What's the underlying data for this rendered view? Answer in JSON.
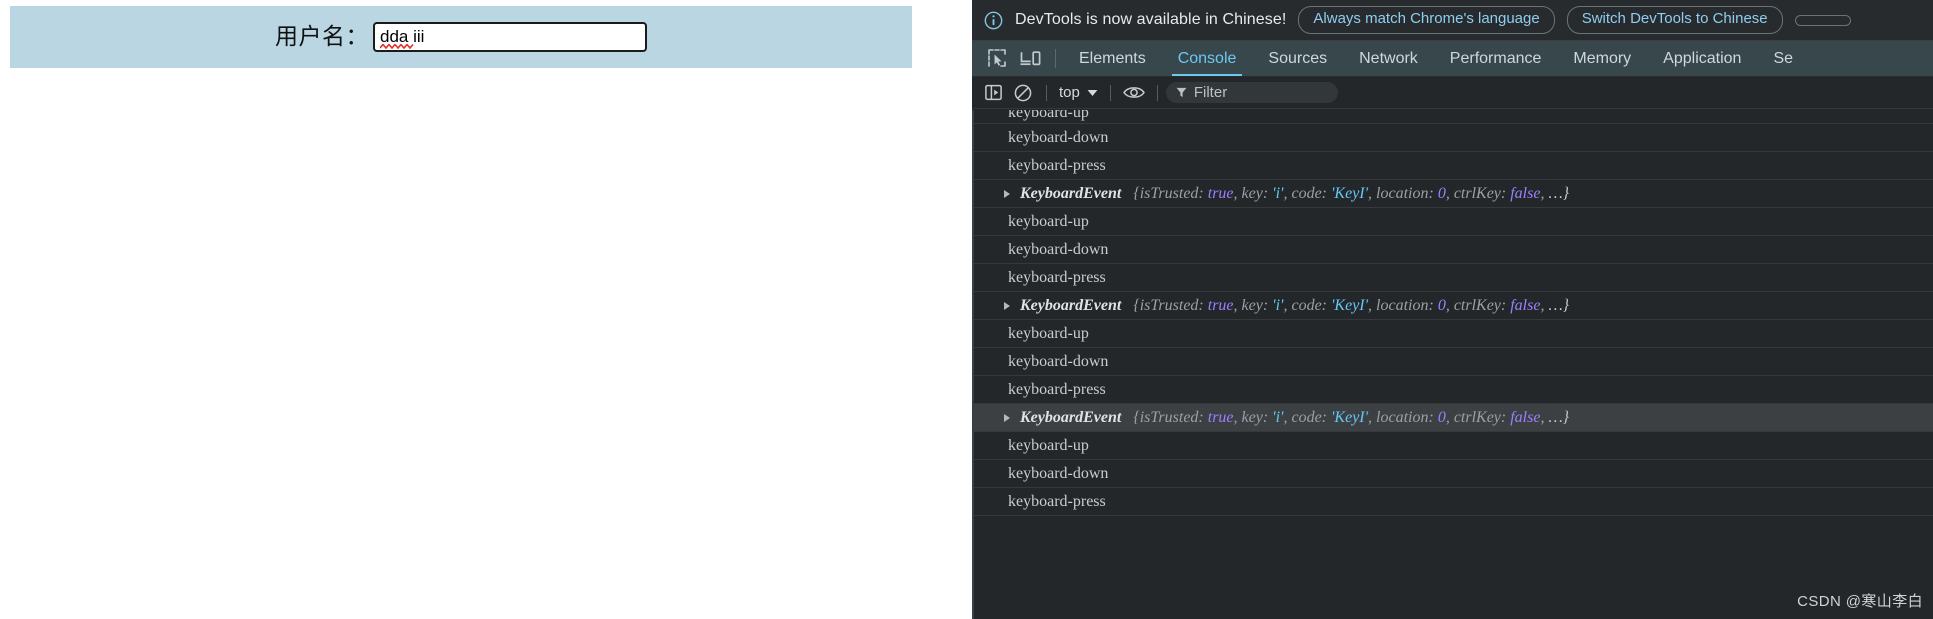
{
  "page": {
    "form": {
      "label": "用户名：",
      "input_value": "dda iii",
      "input_placeholder": ""
    },
    "band_color": "#b9d6e2"
  },
  "devtools": {
    "infobar": {
      "icon": "info-circle-icon",
      "message": "DevTools is now available in Chinese!",
      "buttons": [
        {
          "label": "Always match Chrome's language"
        },
        {
          "label": "Switch DevTools to Chinese"
        },
        {
          "label": ""
        }
      ]
    },
    "tabstrip": {
      "inspect_icon": "inspect-element-icon",
      "device_icon": "device-toolbar-icon",
      "tabs": [
        {
          "label": "Elements",
          "active": false
        },
        {
          "label": "Console",
          "active": true
        },
        {
          "label": "Sources",
          "active": false
        },
        {
          "label": "Network",
          "active": false
        },
        {
          "label": "Performance",
          "active": false
        },
        {
          "label": "Memory",
          "active": false
        },
        {
          "label": "Application",
          "active": false
        },
        {
          "label": "Se",
          "active": false
        }
      ]
    },
    "console_toolbar": {
      "sidebar_icon": "console-sidebar-icon",
      "clear_icon": "clear-console-icon",
      "context": "top",
      "context_caret": "chevron-down-icon",
      "eye_icon": "live-expression-eye-icon",
      "filter_icon": "filter-funnel-icon",
      "filter_placeholder": "Filter",
      "filter_value": ""
    },
    "log": {
      "rows": [
        {
          "type": "text",
          "text": "keyboard-up",
          "clipped": true,
          "highlight": false
        },
        {
          "type": "text",
          "text": "keyboard-down",
          "clipped": false,
          "highlight": false
        },
        {
          "type": "text",
          "text": "keyboard-press",
          "clipped": false,
          "highlight": false
        },
        {
          "type": "object",
          "name": "KeyboardEvent",
          "props": [
            {
              "key": "isTrusted",
              "value": "true",
              "kind": "bool"
            },
            {
              "key": "key",
              "value": "'i'",
              "kind": "str"
            },
            {
              "key": "code",
              "value": "'KeyI'",
              "kind": "str"
            },
            {
              "key": "location",
              "value": "0",
              "kind": "num"
            },
            {
              "key": "ctrlKey",
              "value": "false",
              "kind": "bool"
            }
          ],
          "ellipsis": "…}",
          "highlight": false
        },
        {
          "type": "text",
          "text": "keyboard-up",
          "clipped": false,
          "highlight": false
        },
        {
          "type": "text",
          "text": "keyboard-down",
          "clipped": false,
          "highlight": false
        },
        {
          "type": "text",
          "text": "keyboard-press",
          "clipped": false,
          "highlight": false
        },
        {
          "type": "object",
          "name": "KeyboardEvent",
          "props": [
            {
              "key": "isTrusted",
              "value": "true",
              "kind": "bool"
            },
            {
              "key": "key",
              "value": "'i'",
              "kind": "str"
            },
            {
              "key": "code",
              "value": "'KeyI'",
              "kind": "str"
            },
            {
              "key": "location",
              "value": "0",
              "kind": "num"
            },
            {
              "key": "ctrlKey",
              "value": "false",
              "kind": "bool"
            }
          ],
          "ellipsis": "…}",
          "highlight": false
        },
        {
          "type": "text",
          "text": "keyboard-up",
          "clipped": false,
          "highlight": false
        },
        {
          "type": "text",
          "text": "keyboard-down",
          "clipped": false,
          "highlight": false
        },
        {
          "type": "text",
          "text": "keyboard-press",
          "clipped": false,
          "highlight": false
        },
        {
          "type": "object",
          "name": "KeyboardEvent",
          "props": [
            {
              "key": "isTrusted",
              "value": "true",
              "kind": "bool"
            },
            {
              "key": "key",
              "value": "'i'",
              "kind": "str"
            },
            {
              "key": "code",
              "value": "'KeyI'",
              "kind": "str"
            },
            {
              "key": "location",
              "value": "0",
              "kind": "num"
            },
            {
              "key": "ctrlKey",
              "value": "false",
              "kind": "bool"
            }
          ],
          "ellipsis": "…}",
          "highlight": true
        },
        {
          "type": "text",
          "text": "keyboard-up",
          "clipped": false,
          "highlight": false
        },
        {
          "type": "text",
          "text": "keyboard-down",
          "clipped": false,
          "highlight": false
        },
        {
          "type": "text",
          "text": "keyboard-press",
          "clipped": false,
          "highlight": false
        }
      ]
    },
    "watermark": "CSDN @寒山李白"
  }
}
